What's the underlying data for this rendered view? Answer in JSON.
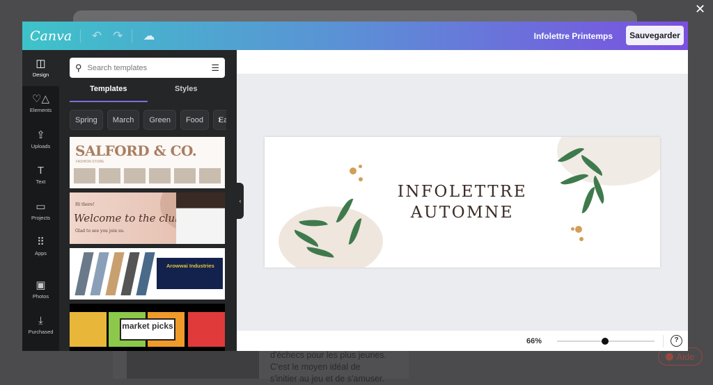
{
  "background": {
    "body_text": "d'échecs pour les plus jeunes. C'est le moyen idéal de s'initier au jeu et de s'amuser.",
    "help_label": "Aide",
    "close_icon": "close-icon"
  },
  "header": {
    "logo": "Canva",
    "undo_icon": "undo-icon",
    "redo_icon": "redo-icon",
    "cloud_icon": "cloud-sync-icon",
    "document_title": "Infolettre Printemps",
    "save_label": "Sauvegarder"
  },
  "rail": {
    "items": [
      {
        "label": "Design",
        "icon": "layout-icon"
      },
      {
        "label": "Elements",
        "icon": "shapes-icon"
      },
      {
        "label": "Uploads",
        "icon": "upload-icon"
      },
      {
        "label": "Text",
        "icon": "text-icon"
      },
      {
        "label": "Projects",
        "icon": "folder-icon"
      },
      {
        "label": "Apps",
        "icon": "grid-icon"
      },
      {
        "label": "Photos",
        "icon": "image-icon"
      },
      {
        "label": "Purchased",
        "icon": "download-icon"
      }
    ]
  },
  "panel": {
    "search_placeholder": "Search templates",
    "tabs": [
      "Templates",
      "Styles"
    ],
    "active_tab": "Templates",
    "chips": [
      "Spring",
      "March",
      "Green",
      "Food",
      "Easter"
    ],
    "templates": [
      {
        "title": "SALFORD & CO.",
        "subtitle": "FASHION STORE"
      },
      {
        "greeting": "Hi there!",
        "title": "Welcome to the club!",
        "subtitle": "Glad to see you join us."
      },
      {
        "title": "Arowwai Industries"
      },
      {
        "title": "market picks"
      }
    ]
  },
  "canvas": {
    "design_text_line1": "INFOLETTRE",
    "design_text_line2": "AUTOMNE"
  },
  "footer": {
    "zoom_label": "66%",
    "zoom_slider_fraction": 0.49,
    "help_icon": "?"
  },
  "colors": {
    "header_start": "#3ec3c9",
    "header_end": "#7b4fe0",
    "tab_underline": "#7d6ee0"
  }
}
